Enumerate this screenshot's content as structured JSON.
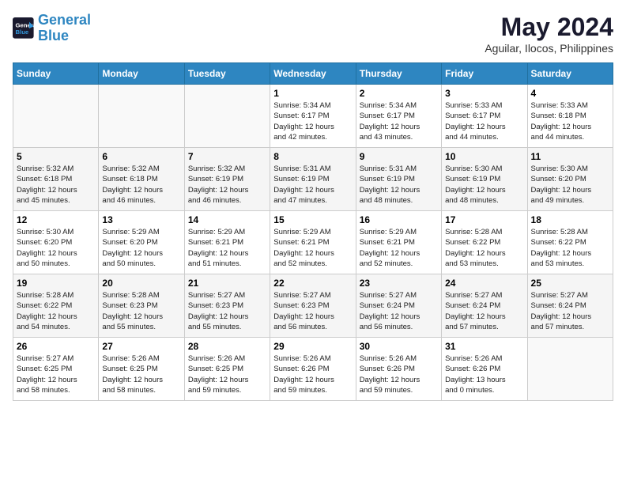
{
  "header": {
    "logo_line1": "General",
    "logo_line2": "Blue",
    "month_year": "May 2024",
    "location": "Aguilar, Ilocos, Philippines"
  },
  "weekdays": [
    "Sunday",
    "Monday",
    "Tuesday",
    "Wednesday",
    "Thursday",
    "Friday",
    "Saturday"
  ],
  "weeks": [
    [
      {
        "day": "",
        "info": ""
      },
      {
        "day": "",
        "info": ""
      },
      {
        "day": "",
        "info": ""
      },
      {
        "day": "1",
        "info": "Sunrise: 5:34 AM\nSunset: 6:17 PM\nDaylight: 12 hours\nand 42 minutes."
      },
      {
        "day": "2",
        "info": "Sunrise: 5:34 AM\nSunset: 6:17 PM\nDaylight: 12 hours\nand 43 minutes."
      },
      {
        "day": "3",
        "info": "Sunrise: 5:33 AM\nSunset: 6:17 PM\nDaylight: 12 hours\nand 44 minutes."
      },
      {
        "day": "4",
        "info": "Sunrise: 5:33 AM\nSunset: 6:18 PM\nDaylight: 12 hours\nand 44 minutes."
      }
    ],
    [
      {
        "day": "5",
        "info": "Sunrise: 5:32 AM\nSunset: 6:18 PM\nDaylight: 12 hours\nand 45 minutes."
      },
      {
        "day": "6",
        "info": "Sunrise: 5:32 AM\nSunset: 6:18 PM\nDaylight: 12 hours\nand 46 minutes."
      },
      {
        "day": "7",
        "info": "Sunrise: 5:32 AM\nSunset: 6:19 PM\nDaylight: 12 hours\nand 46 minutes."
      },
      {
        "day": "8",
        "info": "Sunrise: 5:31 AM\nSunset: 6:19 PM\nDaylight: 12 hours\nand 47 minutes."
      },
      {
        "day": "9",
        "info": "Sunrise: 5:31 AM\nSunset: 6:19 PM\nDaylight: 12 hours\nand 48 minutes."
      },
      {
        "day": "10",
        "info": "Sunrise: 5:30 AM\nSunset: 6:19 PM\nDaylight: 12 hours\nand 48 minutes."
      },
      {
        "day": "11",
        "info": "Sunrise: 5:30 AM\nSunset: 6:20 PM\nDaylight: 12 hours\nand 49 minutes."
      }
    ],
    [
      {
        "day": "12",
        "info": "Sunrise: 5:30 AM\nSunset: 6:20 PM\nDaylight: 12 hours\nand 50 minutes."
      },
      {
        "day": "13",
        "info": "Sunrise: 5:29 AM\nSunset: 6:20 PM\nDaylight: 12 hours\nand 50 minutes."
      },
      {
        "day": "14",
        "info": "Sunrise: 5:29 AM\nSunset: 6:21 PM\nDaylight: 12 hours\nand 51 minutes."
      },
      {
        "day": "15",
        "info": "Sunrise: 5:29 AM\nSunset: 6:21 PM\nDaylight: 12 hours\nand 52 minutes."
      },
      {
        "day": "16",
        "info": "Sunrise: 5:29 AM\nSunset: 6:21 PM\nDaylight: 12 hours\nand 52 minutes."
      },
      {
        "day": "17",
        "info": "Sunrise: 5:28 AM\nSunset: 6:22 PM\nDaylight: 12 hours\nand 53 minutes."
      },
      {
        "day": "18",
        "info": "Sunrise: 5:28 AM\nSunset: 6:22 PM\nDaylight: 12 hours\nand 53 minutes."
      }
    ],
    [
      {
        "day": "19",
        "info": "Sunrise: 5:28 AM\nSunset: 6:22 PM\nDaylight: 12 hours\nand 54 minutes."
      },
      {
        "day": "20",
        "info": "Sunrise: 5:28 AM\nSunset: 6:23 PM\nDaylight: 12 hours\nand 55 minutes."
      },
      {
        "day": "21",
        "info": "Sunrise: 5:27 AM\nSunset: 6:23 PM\nDaylight: 12 hours\nand 55 minutes."
      },
      {
        "day": "22",
        "info": "Sunrise: 5:27 AM\nSunset: 6:23 PM\nDaylight: 12 hours\nand 56 minutes."
      },
      {
        "day": "23",
        "info": "Sunrise: 5:27 AM\nSunset: 6:24 PM\nDaylight: 12 hours\nand 56 minutes."
      },
      {
        "day": "24",
        "info": "Sunrise: 5:27 AM\nSunset: 6:24 PM\nDaylight: 12 hours\nand 57 minutes."
      },
      {
        "day": "25",
        "info": "Sunrise: 5:27 AM\nSunset: 6:24 PM\nDaylight: 12 hours\nand 57 minutes."
      }
    ],
    [
      {
        "day": "26",
        "info": "Sunrise: 5:27 AM\nSunset: 6:25 PM\nDaylight: 12 hours\nand 58 minutes."
      },
      {
        "day": "27",
        "info": "Sunrise: 5:26 AM\nSunset: 6:25 PM\nDaylight: 12 hours\nand 58 minutes."
      },
      {
        "day": "28",
        "info": "Sunrise: 5:26 AM\nSunset: 6:25 PM\nDaylight: 12 hours\nand 59 minutes."
      },
      {
        "day": "29",
        "info": "Sunrise: 5:26 AM\nSunset: 6:26 PM\nDaylight: 12 hours\nand 59 minutes."
      },
      {
        "day": "30",
        "info": "Sunrise: 5:26 AM\nSunset: 6:26 PM\nDaylight: 12 hours\nand 59 minutes."
      },
      {
        "day": "31",
        "info": "Sunrise: 5:26 AM\nSunset: 6:26 PM\nDaylight: 13 hours\nand 0 minutes."
      },
      {
        "day": "",
        "info": ""
      }
    ]
  ]
}
